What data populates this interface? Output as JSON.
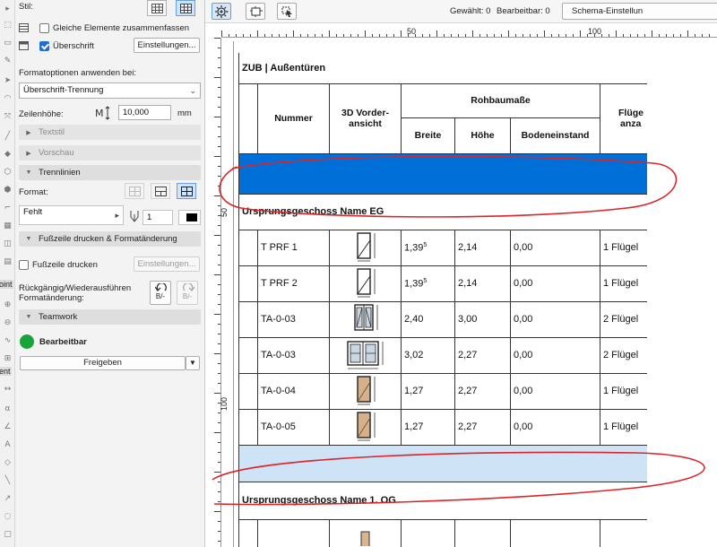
{
  "toolstrip": {
    "labels": [
      "oint",
      "ent"
    ]
  },
  "panel": {
    "style_label": "Stil:",
    "merge_label": "Gleiche Elemente zusammenfassen",
    "merge_checked": false,
    "heading_label": "Überschrift",
    "heading_checked": true,
    "settings_button": "Einstellungen...",
    "apply_format_label": "Formatoptionen anwenden bei:",
    "apply_format_value": "Überschrift-Trennung",
    "row_height_label": "Zeilenhöhe:",
    "row_height_value": "10,000",
    "row_height_unit": "mm",
    "sections": {
      "text_style": "Textstil",
      "preview": "Vorschau",
      "separators": "Trennlinien",
      "footer": "Fußzeile drucken & Formatänderung",
      "teamwork": "Teamwork"
    },
    "format_label": "Format:",
    "line_type_value": "Fehlt",
    "pen_value": "1",
    "footer_print_label": "Fußzeile drucken",
    "footer_settings_button": "Einstellungen...",
    "undo_label_1": "Rückgängig/Wiederausführen",
    "undo_label_2": "Formatänderung:",
    "undo_button": "B/-",
    "redo_button": "B/-",
    "teamwork_status": "Bearbeitbar",
    "teamwork_status_color": "#1aa33a",
    "release_button": "Freigeben"
  },
  "toolbar": {
    "selected": "Gewählt: 0",
    "editable": "Bearbeitbar: 0",
    "schema_button": "Schema-Einstellun"
  },
  "ruler": {
    "h_ticks": [
      "50",
      "100"
    ],
    "v_ticks": [
      "50",
      "100"
    ]
  },
  "schedule": {
    "title": "ZUB | Außentüren",
    "headers": {
      "number": "Nummer",
      "view3d_1": "3D Vorder-",
      "view3d_2": "ansicht",
      "rough": "Rohbaumaße",
      "width": "Breite",
      "height": "Höhe",
      "floor_level": "Bodeneinstand",
      "leaves_1": "Flüge",
      "leaves_2": "anza"
    },
    "group1": "Ursprungsgeschoss Name  EG",
    "group2": "Ursprungsgeschoss Name  1. OG",
    "rows": [
      {
        "nummer": "T PRF 1",
        "breite": "1,39",
        "breite_sup": "5",
        "hoehe": "2,14",
        "boden": "0,00",
        "fluegel": "1 Flügel",
        "door": "single-frame"
      },
      {
        "nummer": "T PRF 2",
        "breite": "1,39",
        "breite_sup": "5",
        "hoehe": "2,14",
        "boden": "0,00",
        "fluegel": "1 Flügel",
        "door": "single-frame"
      },
      {
        "nummer": "TA-0-03",
        "breite": "2,40",
        "breite_sup": "",
        "hoehe": "3,00",
        "boden": "0,00",
        "fluegel": "2 Flügel",
        "door": "double-glazed"
      },
      {
        "nummer": "TA-0-03",
        "breite": "3,02",
        "breite_sup": "",
        "hoehe": "2,27",
        "boden": "0,00",
        "fluegel": "2 Flügel",
        "door": "double-wide"
      },
      {
        "nummer": "TA-0-04",
        "breite": "1,27",
        "breite_sup": "",
        "hoehe": "2,27",
        "boden": "0,00",
        "fluegel": "1 Flügel",
        "door": "single-wood"
      },
      {
        "nummer": "TA-0-05",
        "breite": "1,27",
        "breite_sup": "",
        "hoehe": "2,27",
        "boden": "0,00",
        "fluegel": "1 Flügel",
        "door": "single-wood"
      }
    ],
    "separator_colors": {
      "dark": "#0070d8",
      "light": "#cfe3f7"
    }
  }
}
